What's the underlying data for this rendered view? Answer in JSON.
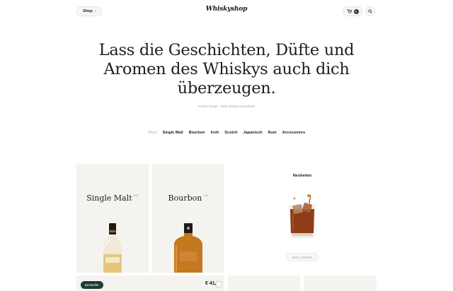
{
  "header": {
    "shop_label": "Shop",
    "shop_chevron": "↕",
    "logo": "Whiskyshop",
    "cart_count": "0",
    "icons": {
      "cart": "cart-icon",
      "search": "search-icon",
      "shop_chevron": "chevron-up-down-icon"
    }
  },
  "hero": {
    "line1": "Lass die Geschichten, Düfte und",
    "line2": "Aromen des Whiskys auch dich",
    "line3": "überzeugen.",
    "byline": "Robert Singer - Dein Whisky Consultant"
  },
  "categories": [
    {
      "label": "Shop",
      "active": true
    },
    {
      "label": "Single Malt",
      "active": false
    },
    {
      "label": "Bourbon",
      "active": false
    },
    {
      "label": "Irish",
      "active": false
    },
    {
      "label": "Scotch",
      "active": false
    },
    {
      "label": "Japanisch",
      "active": false
    },
    {
      "label": "Rum",
      "active": false
    },
    {
      "label": "Accessoires",
      "active": false
    }
  ],
  "cards": {
    "single_malt": {
      "title": "Single Malt",
      "count": "(35)"
    },
    "bourbon": {
      "title": "Bourbon",
      "count": "(35)"
    }
  },
  "news": {
    "title": "Neuheiten",
    "button": "Mehr erfahren"
  },
  "bottom": {
    "badge": "Bestseller",
    "price": "€ 41,"
  },
  "colors": {
    "accent": "#1f3d33",
    "card_bg": "#f4f3f0",
    "muted_text": "#a8a8a8"
  }
}
